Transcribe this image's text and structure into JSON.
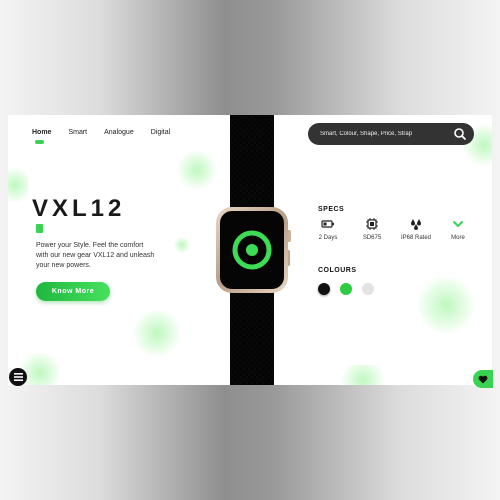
{
  "nav": {
    "items": [
      {
        "label": "Home",
        "active": true
      },
      {
        "label": "Smart",
        "active": false
      },
      {
        "label": "Analogue",
        "active": false
      },
      {
        "label": "Digital",
        "active": false
      }
    ]
  },
  "search": {
    "placeholder": "Smart, Colour, Shape, Price, Strap",
    "icon": "search-icon"
  },
  "product": {
    "name": "VXL12",
    "description": "Power your Style. Feel the comfort with our new gear VXL12 and unleash your new powers.",
    "cta_label": "Know More"
  },
  "specs": {
    "title": "SPECS",
    "items": [
      {
        "icon": "battery-icon",
        "label": "2 Days"
      },
      {
        "icon": "chip-icon",
        "label": "SD675"
      },
      {
        "icon": "water-drops-icon",
        "label": "IP68 Rated"
      },
      {
        "icon": "chevron-down-icon",
        "label": "More"
      }
    ]
  },
  "colours": {
    "title": "COLOURS",
    "options": [
      {
        "name": "black",
        "hex": "#111111"
      },
      {
        "name": "green",
        "hex": "#2ecc40"
      },
      {
        "name": "white",
        "hex": "#e3e3e3"
      }
    ]
  },
  "theme": {
    "accent": "#39d353",
    "dark": "#333333"
  },
  "icons": {
    "menu": "menu-icon",
    "favorite": "heart-icon",
    "watch_face": "activity-ring-icon"
  }
}
